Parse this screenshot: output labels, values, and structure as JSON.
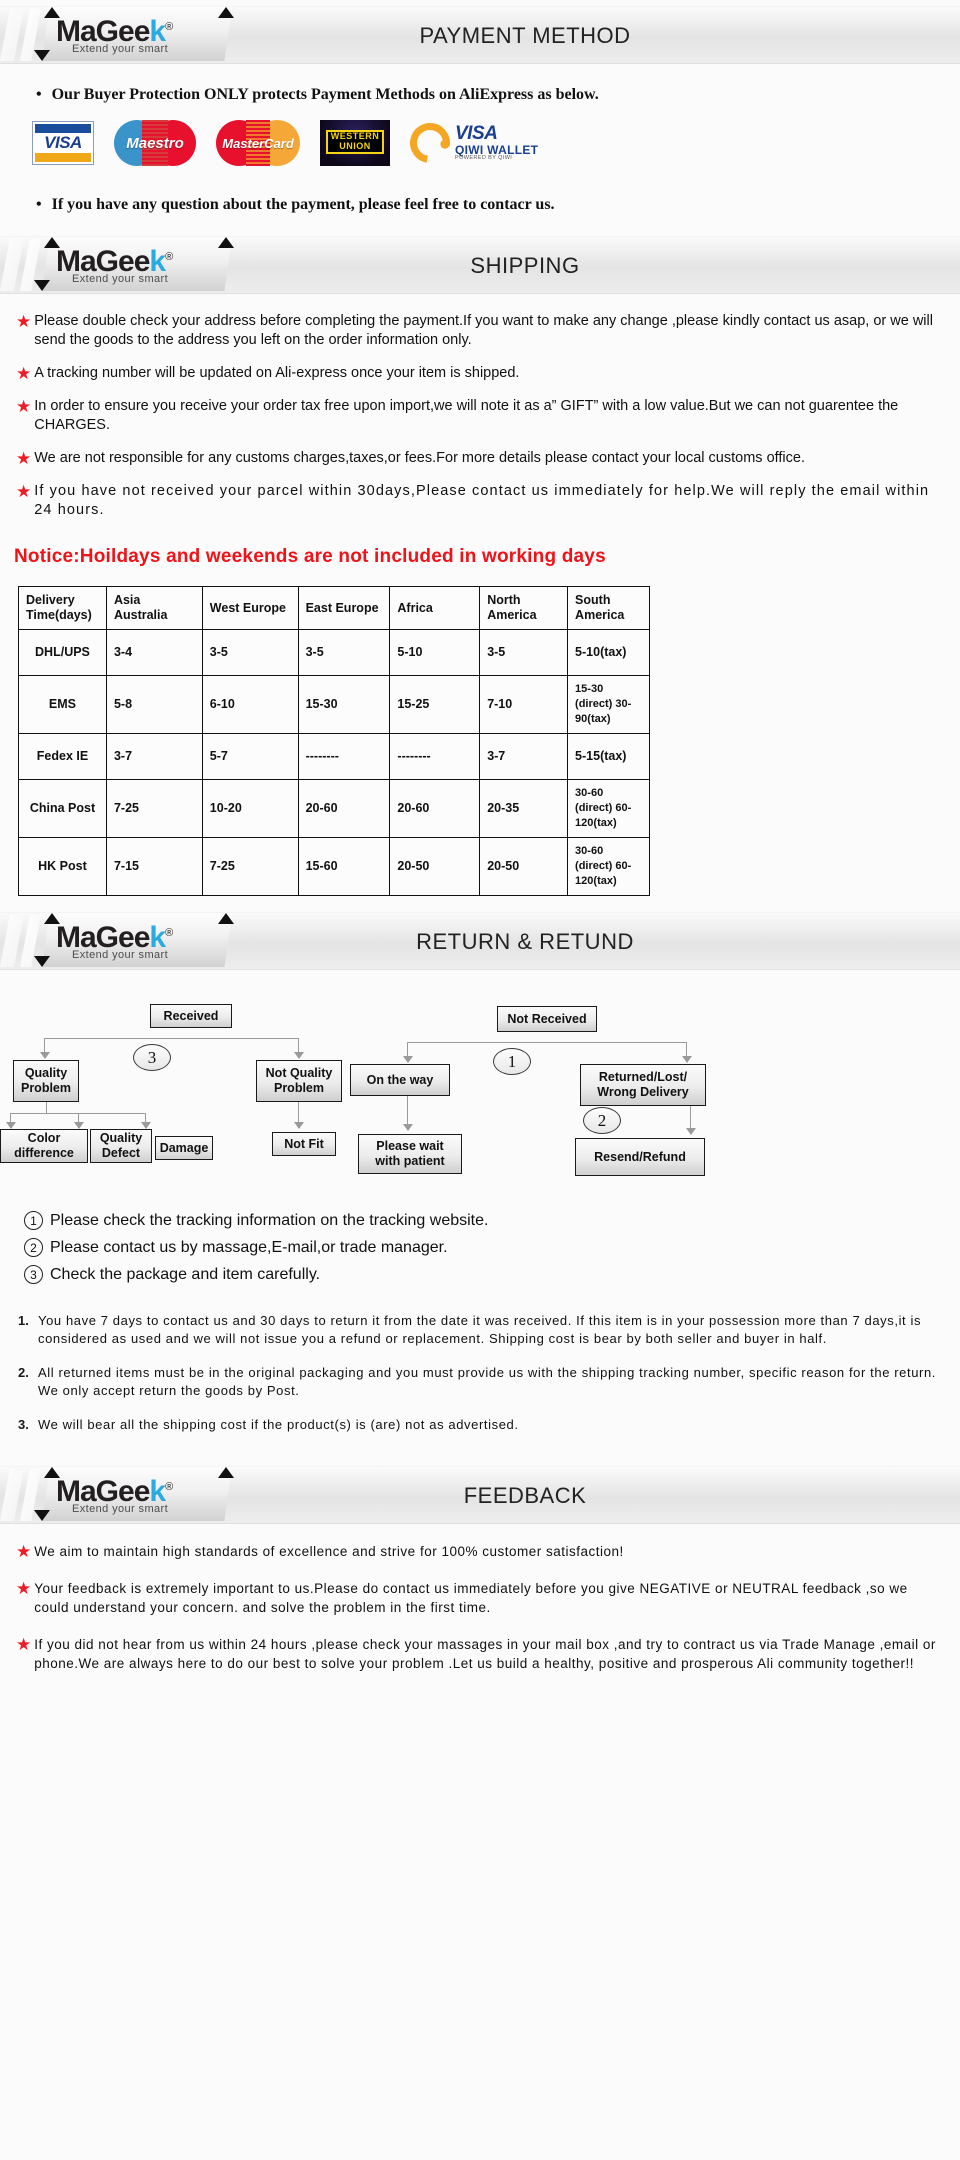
{
  "brand": {
    "name_part1": "MaGee",
    "name_k": "k",
    "registered": "®",
    "tagline": "Extend your smart"
  },
  "sections": {
    "payment": {
      "title": "PAYMENT METHOD",
      "line1": "Our Buyer Protection ONLY protects Payment Methods on AliExpress as below.",
      "line2": "If you have any question about the payment, please feel free to contacr us.",
      "logos": [
        {
          "name": "visa-logo",
          "label": "VISA"
        },
        {
          "name": "maestro-logo",
          "label": "Maestro"
        },
        {
          "name": "mastercard-logo",
          "label": "MasterCard"
        },
        {
          "name": "western-union-logo",
          "label_top": "WESTERN",
          "label_bottom": "UNION"
        },
        {
          "name": "qiwi-wallet-logo",
          "label_a": "VISA",
          "label_b": "QIWI WALLET",
          "label_c": "POWERED BY QIWI"
        }
      ]
    },
    "shipping": {
      "title": "SHIPPING",
      "bullets": [
        "Please double check your address before completing the payment.If you want to make any change ,please kindly contact us asap, or we will send the goods to the address you left on the order information only.",
        "A tracking number will be updated on Ali-express once your item is shipped.",
        "In order to ensure you receive your order tax free upon import,we will note it as a” GIFT” with a low value.But we can not guarentee the CHARGES.",
        "We are not responsible for any customs charges,taxes,or fees.For more details please contact your local customs office.",
        "If you have not received your parcel within 30days,Please contact us immediately for help.We will reply the email within 24 hours."
      ],
      "notice": "Notice:Hoildays and weekends are not included in working days",
      "table": {
        "headers": [
          "Delivery Time(days)",
          "Asia Australia",
          "West Europe",
          "East Europe",
          "Africa",
          "North America",
          "South America"
        ],
        "rows": [
          {
            "carrier": "DHL/UPS",
            "values": [
              "3-4",
              "3-5",
              "3-5",
              "5-10",
              "3-5",
              "5-10(tax)"
            ]
          },
          {
            "carrier": "EMS",
            "values": [
              "5-8",
              "6-10",
              "15-30",
              "15-25",
              "7-10",
              "15-30 (direct) 30-90(tax)"
            ]
          },
          {
            "carrier": "Fedex IE",
            "values": [
              "3-7",
              "5-7",
              "--------",
              "--------",
              "3-7",
              "5-15(tax)"
            ]
          },
          {
            "carrier": "China Post",
            "values": [
              "7-25",
              "10-20",
              "20-60",
              "20-60",
              "20-35",
              "30-60 (direct) 60-120(tax)"
            ]
          },
          {
            "carrier": "HK Post",
            "values": [
              "7-15",
              "7-25",
              "15-60",
              "20-50",
              "20-50",
              "30-60 (direct) 60-120(tax)"
            ]
          }
        ]
      }
    },
    "return": {
      "title": "RETURN & RETUND",
      "flow_left": {
        "root": "Received",
        "marker": "3",
        "branch_a": "Quality Problem",
        "branch_b": "Not Quality Problem",
        "leaves_a": [
          "Color difference",
          "Quality Defect",
          "Damage"
        ],
        "leaf_b": "Not Fit"
      },
      "flow_right": {
        "root": "Not  Received",
        "marker1": "1",
        "marker2": "2",
        "branch_a": "On the way",
        "branch_b": "Returned/Lost/ Wrong Delivery",
        "leaf_a": "Please wait with patient",
        "leaf_b": "Resend/Refund"
      },
      "circled_notes": [
        {
          "num": "1",
          "text": "Please check the tracking information on the tracking website."
        },
        {
          "num": "2",
          "text": "Please contact us by  massage,E-mail,or trade manager."
        },
        {
          "num": "3",
          "text": "Check the package and item carefully."
        }
      ],
      "policies": [
        {
          "num": "1.",
          "text": "You have 7 days to contact us and 30 days to return it from the date it was received. If this item is in your possession more than 7 days,it is considered as used and we will not issue you a refund or replacement. Shipping cost is bear by both seller and buyer in half."
        },
        {
          "num": "2.",
          "text": "All returned items must be in the original packaging and you must provide us with the shipping tracking number, specific reason for the return. We only accept return the goods by Post."
        },
        {
          "num": "3.",
          "text": "We will bear all the shipping cost if the product(s) is (are) not as advertised."
        }
      ]
    },
    "feedback": {
      "title": "FEEDBACK",
      "bullets": [
        "We aim to maintain high standards of excellence and strive  for 100% customer satisfaction!",
        "Your feedback is extremely important to us.Please do contact us immediately before you give NEGATIVE or NEUTRAL feedback ,so  we could understand your concern. and solve the problem in the first time.",
        "If you did not hear from us within 24 hours ,please check your massages in your mail box ,and try to contract us via Trade Manage ,email or phone.We are always here to do our best to solve your problem .Let us build a healthy, positive and prosperous Ali community together!!"
      ]
    }
  },
  "colors": {
    "star_red": "#ef1b26",
    "notice_red": "#f01217",
    "logo_blue": "#29abe2"
  }
}
